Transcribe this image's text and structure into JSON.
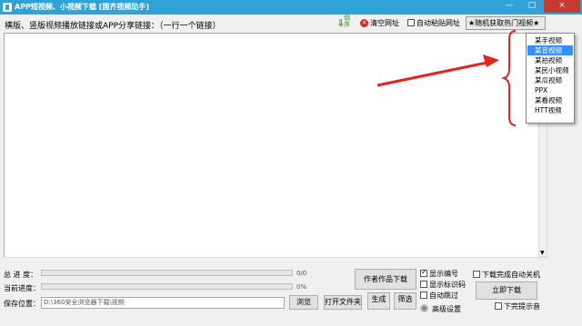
{
  "window": {
    "title": "APP短视频、小视频下载 [国齐视频助手]",
    "controls": {
      "minimize": "—",
      "maximize": "□",
      "close": "×"
    }
  },
  "toolbar": {
    "instruction": "横版、竖版视频播放链接或APP分享链接：（一行一个链接）",
    "import_label": "倒序",
    "clear_label": "清空网址",
    "clear_icon": "x-circle-icon",
    "auto_paste_label": "自动粘贴网址",
    "auto_paste_checked": false,
    "hot_videos_label": "★随机获取热门视频★"
  },
  "dropdown": {
    "items": [
      "某手视频",
      "某音视频",
      "某拍视频",
      "某民小视频",
      "某瓜视频",
      "PPX",
      "某看视频",
      "HTT视频"
    ],
    "selected_index": 1
  },
  "annotation": {
    "arrow_color": "#e8231a",
    "brace_color": "#e8231a"
  },
  "status": {
    "total_label": "总 进 度：",
    "total_value": "0/0",
    "current_label": "当前进度：",
    "current_value": "0%",
    "save_label": "保存位置：",
    "save_path": "D:\\360安全浏览器下载\\视频"
  },
  "buttons": {
    "browse": "浏览",
    "open_folder": "打开文件夹",
    "generate": "生成",
    "filter": "筛选",
    "author_download": "作者作品下载",
    "download_now": "立即下载",
    "advanced": "高级设置"
  },
  "options": {
    "show_number": {
      "label": "显示编号",
      "checked": true
    },
    "show_id": {
      "label": "显示标识码",
      "checked": false
    },
    "auto_resume": {
      "label": "自动跳过",
      "checked": false
    },
    "shutdown_after": {
      "label": "下载完成自动关机",
      "checked": false
    },
    "no_prompt": {
      "label": "下完提示音",
      "checked": false
    }
  }
}
